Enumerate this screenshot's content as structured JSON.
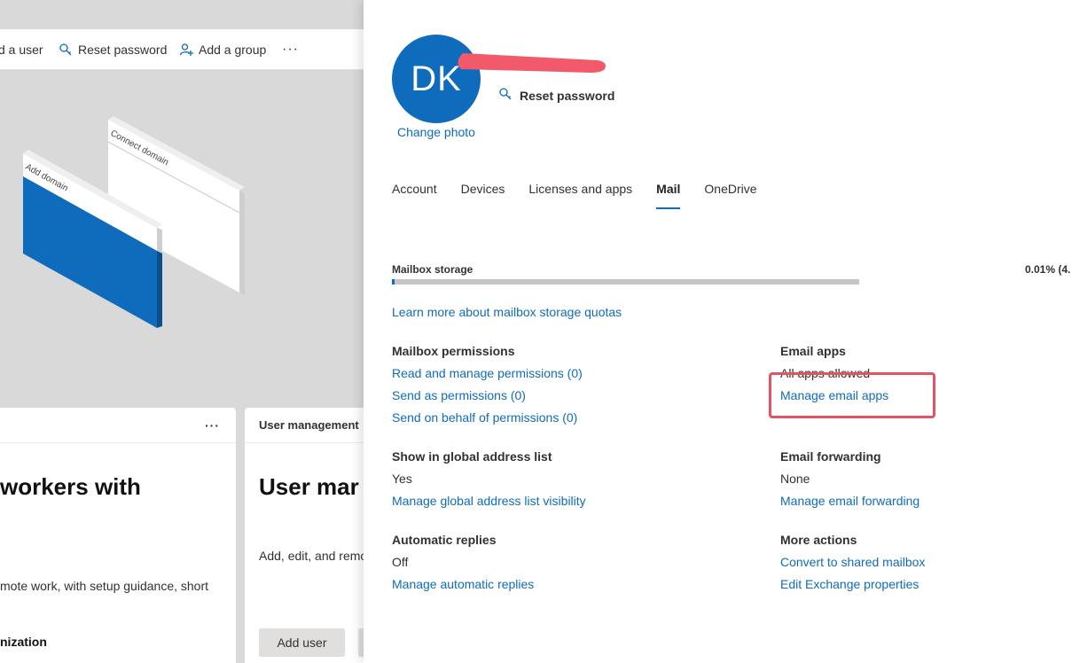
{
  "background": {
    "commandbar": {
      "add_user": "d a user",
      "reset_password": "Reset password",
      "add_group": "Add a group",
      "more": "···"
    },
    "illustration": {
      "card_back_label": "Connect domain",
      "card_front_label": "Add domain"
    },
    "card1": {
      "more": "···",
      "title": "workers with",
      "text": "mote work, with setup guidance, short",
      "subheading": "nization"
    },
    "card2": {
      "header": "User management",
      "title": "User mar",
      "text": "Add, edit, and remo",
      "button": "Add user"
    }
  },
  "panel": {
    "avatar_initials": "DK",
    "change_photo": "Change photo",
    "reset_password": "Reset password",
    "tabs": [
      {
        "label": "Account",
        "active": false
      },
      {
        "label": "Devices",
        "active": false
      },
      {
        "label": "Licenses and apps",
        "active": false
      },
      {
        "label": "Mail",
        "active": true
      },
      {
        "label": "OneDrive",
        "active": false
      }
    ],
    "mailbox_storage": {
      "label": "Mailbox storage",
      "value": "0.01% (4.",
      "percent_used": 0.01,
      "learn_more": "Learn more about mailbox storage quotas"
    },
    "mailbox_permissions": {
      "heading": "Mailbox permissions",
      "links": [
        "Read and manage permissions (0)",
        "Send as permissions (0)",
        "Send on behalf of permissions (0)"
      ]
    },
    "email_apps": {
      "heading": "Email apps",
      "value": "All apps allowed",
      "link": "Manage email apps"
    },
    "global_address_list": {
      "heading": "Show in global address list",
      "value": "Yes",
      "link": "Manage global address list visibility"
    },
    "email_forwarding": {
      "heading": "Email forwarding",
      "value": "None",
      "link": "Manage email forwarding"
    },
    "automatic_replies": {
      "heading": "Automatic replies",
      "value": "Off",
      "link": "Manage automatic replies"
    },
    "more_actions": {
      "heading": "More actions",
      "links": [
        "Convert to shared mailbox",
        "Edit Exchange properties"
      ]
    }
  },
  "colors": {
    "accent": "#0f6cbd",
    "highlight": "#e05463",
    "redaction": "#f25a6b"
  }
}
